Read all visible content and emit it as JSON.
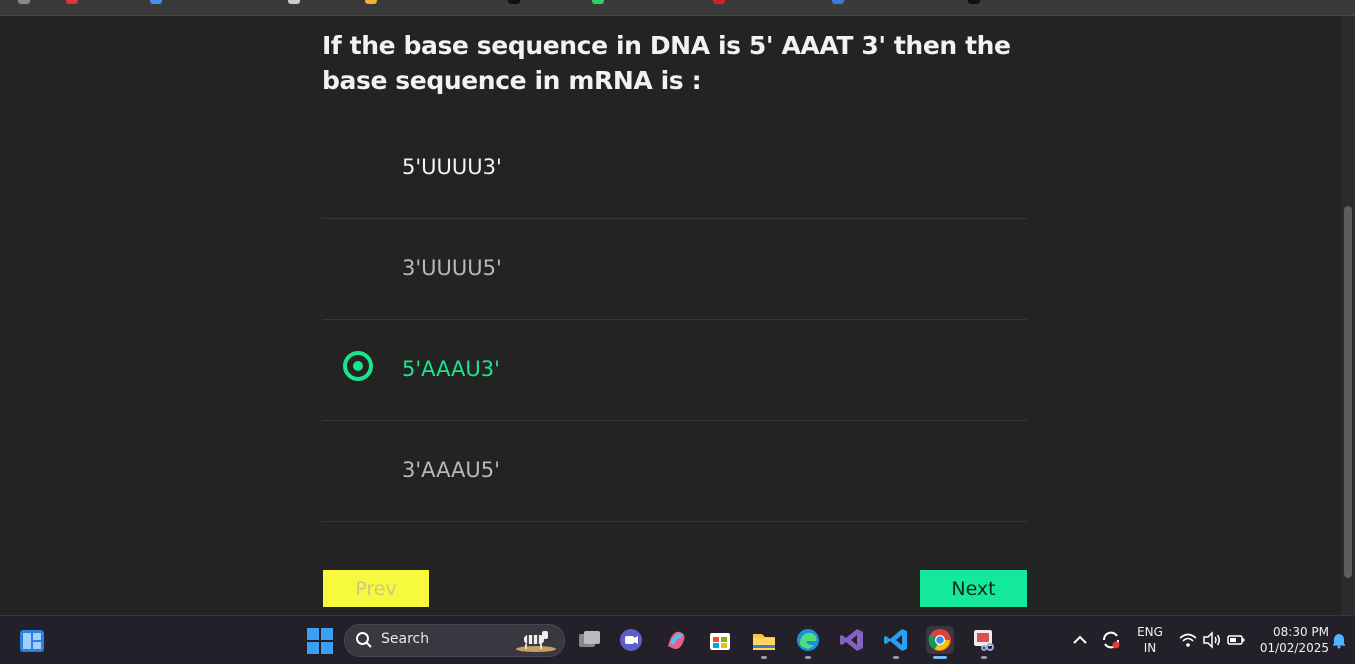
{
  "quiz": {
    "question": "If the base sequence in DNA is 5' AAAT 3' then the base sequence in mRNA is :",
    "options": [
      {
        "label": "5'UUUU3'",
        "selected": false
      },
      {
        "label": "3'UUUU5'",
        "selected": false
      },
      {
        "label": "5'AAAU3'",
        "selected": true
      },
      {
        "label": "3'AAAU5'",
        "selected": false
      }
    ],
    "prev_label": "Prev",
    "next_label": "Next"
  },
  "taskbar": {
    "search_placeholder": "Search",
    "language": "ENG",
    "region": "IN",
    "time": "08:30 PM",
    "date": "01/02/2025"
  },
  "colors": {
    "accent_green": "#19e68c",
    "prev_yellow": "#f7f93d",
    "next_green": "#14e89a",
    "background": "#232323"
  }
}
